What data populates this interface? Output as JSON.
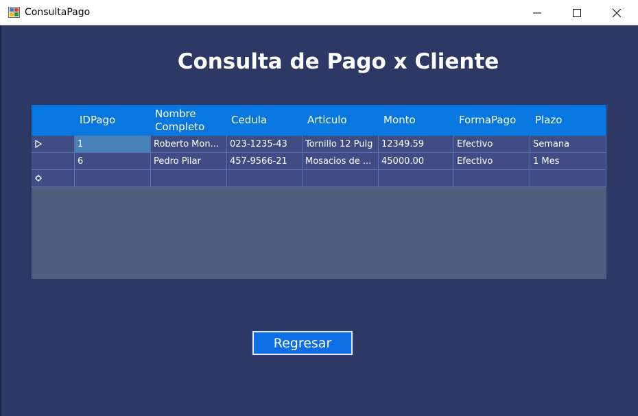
{
  "window": {
    "title": "ConsultaPago"
  },
  "heading": "Consulta de Pago x Cliente",
  "grid": {
    "columns": [
      "IDPago",
      "Nombre Completo",
      "Cedula",
      "Articulo",
      "Monto",
      "FormaPago",
      "Plazo"
    ],
    "rows": [
      {
        "idpago": "1",
        "nombre": "Roberto Mon...",
        "cedula": "023-1235-43",
        "articulo": "Tornillo 12 Pulg",
        "monto": "12349.59",
        "formapago": "Efectivo",
        "plazo": "Semana"
      },
      {
        "idpago": "6",
        "nombre": "Pedro  Pilar",
        "cedula": "457-9566-21",
        "articulo": "Mosacios de ...",
        "monto": "45000.00",
        "formapago": "Efectivo",
        "plazo": "1 Mes"
      }
    ]
  },
  "buttons": {
    "regresar": "Regresar"
  }
}
